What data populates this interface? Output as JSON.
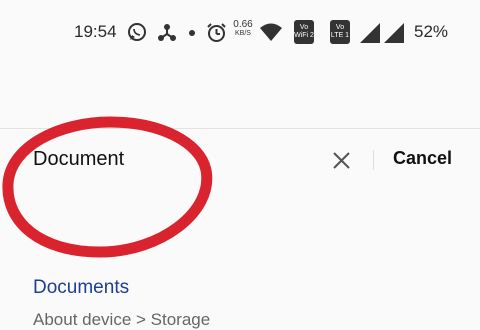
{
  "status_bar": {
    "time": "19:54",
    "net_speed_value": "0.66",
    "net_speed_unit": "KB/S",
    "vowifi_top": "Vo",
    "vowifi_bottom": "WiFi 2",
    "volte_top": "Vo",
    "volte_bottom": "LTE 1",
    "battery": "52%"
  },
  "search": {
    "query": "Document",
    "cancel_label": "Cancel"
  },
  "results": [
    {
      "title": "Documents",
      "path": "About device > Storage"
    }
  ],
  "colors": {
    "result_title": "#1e3f8f",
    "annotation_circle": "#d9242f"
  }
}
